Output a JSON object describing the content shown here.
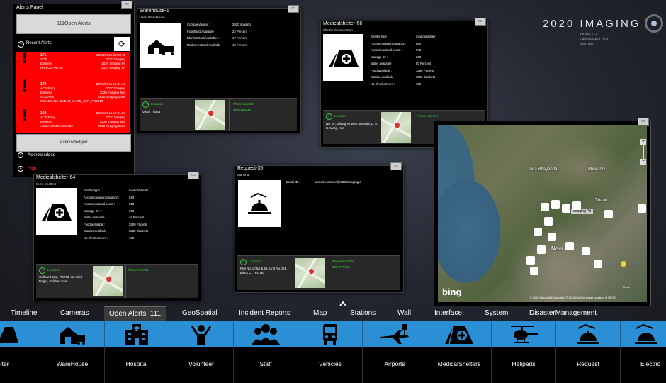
{
  "alerts_panel": {
    "title": "Alerts Panel",
    "open_alerts_button": "111Open Alerts",
    "recent_alerts_label": "Recent Alerts",
    "alerts": [
      {
        "id": "171",
        "type": "SOS",
        "level": "Extreme",
        "detail": "HA SOS Alarms",
        "date": "22/04/2013 12:02:11",
        "org": "2020 Imaging",
        "site": "2020 Imaging Pit",
        "zone": "2020 Imaging FA"
      },
      {
        "id": "170",
        "type": "ACS Entry",
        "level": "Extreme",
        "detail": "ACS Alert 3434401460~EVENT_CARD_NOT_FOUND",
        "date": "22/04/2013 12:01:48",
        "org": "2020 Imaging",
        "site": "2020 Imaging Site",
        "zone": "2020 Imaging Zone"
      },
      {
        "id": "169",
        "type": "ACS Entry",
        "level": "Extreme",
        "detail": "ACS Alert 3434401460~",
        "date": "22/04/2013 12:01:27",
        "org": "2020 Imaging",
        "site": "2020 Imaging Site",
        "zone": "2020 Imaging Zone"
      }
    ],
    "acknowledge_button": "Acknowledged",
    "acknowledged_section": "Acknowledged",
    "high_section": "High"
  },
  "warehouse": {
    "title": "Warehouse-1",
    "subtitle": "Vasai WareHouse",
    "fields": [
      {
        "k": "CompanyName :",
        "v": "2020 imaging"
      },
      {
        "k": "FoodStockAvailable :",
        "v": "22 Percent"
      },
      {
        "k": "BlanketStockAvailable :",
        "v": "17 Percent"
      },
      {
        "k": "MedicinesStockAvailable :",
        "v": "42 Percent"
      }
    ],
    "location_label": "Location",
    "location_value": "Vasai Thana",
    "phone_label": "Phone Number",
    "phone_value": "9560395238"
  },
  "shelter66": {
    "title": "Medicalshelter-66",
    "subtitle": "Shelter Incorporation",
    "fields": [
      {
        "k": "Shelter type :",
        "v": "medicalshelter"
      },
      {
        "k": "Accommodation capacity :",
        "v": "880"
      },
      {
        "k": "Accommodated count :",
        "v": "570"
      },
      {
        "k": "Manage By :",
        "v": "330"
      },
      {
        "k": "Water available :",
        "v": "50 Percent"
      },
      {
        "k": "Food available :",
        "v": "3250 Packets"
      },
      {
        "k": "Blanket available :",
        "v": "2950 Blankets"
      },
      {
        "k": "No of Volunteers :",
        "v": "150"
      }
    ],
    "location_label": "Location",
    "location_value": "No. 67, Shivaji Kutwar Marsdal, L. S. S. Marg, Kurl",
    "phone_label": "Phone Number",
    "phone_value": ""
  },
  "shelter64": {
    "title": "Medicalshelter-64",
    "subtitle": "M. K. Shelters",
    "fields": [
      {
        "k": "Shelter type :",
        "v": "medicalshelter"
      },
      {
        "k": "Accommodation capacity :",
        "v": "540"
      },
      {
        "k": "Accommodated count :",
        "v": "510"
      },
      {
        "k": "Manage By :",
        "v": "270"
      },
      {
        "k": "Water available :",
        "v": "46 Percent"
      },
      {
        "k": "Food available :",
        "v": "2800 Packets"
      },
      {
        "k": "Blanket available :",
        "v": "2230 Blankets"
      },
      {
        "k": "No of Volunteers :",
        "v": "130"
      }
    ],
    "location_label": "Location",
    "location_value": "Golibar Naka, 7th Rd, Jai Hind Nagar, Golibar, Sant",
    "phone_label": "Phone Number",
    "phone_value": ""
  },
  "request": {
    "title": "Request-35",
    "subtitle": "Manohar",
    "email_label": "Email ID :",
    "email_value": "santosh.lamane@2020imaging.c",
    "location_label": "Location",
    "location_value": "Plot No. C/ 54 & 55, Unit No.001, Block C, TPC Bu",
    "phone_label": "Phone Number",
    "phone_value": "9004770840"
  },
  "brand": {
    "name": "2020 IMAGING",
    "line1": "Version V1.2",
    "line2": "India Standard Time",
    "line3": "User: ppm"
  },
  "map": {
    "labels": [
      "Mira Bhayandar",
      "Bhiwandi",
      "Thane",
      "Navi",
      "Imaging Pit"
    ],
    "bing": "bing",
    "copyright": "© 2010 Microsoft Corporation   © 2010 GeoEye Image courtesy of USGS",
    "scale": "5 km"
  },
  "menu": {
    "tabs": [
      "Timeline",
      "Cameras",
      "Open Alerts  111",
      "GeoSpatial",
      "Incident Reports",
      "Map",
      "Stations",
      "Wall",
      "Interface",
      "System",
      "DisasterManagement"
    ],
    "active_tab": "Open Alerts  111",
    "tiles": [
      "elter",
      "WareHouse",
      "Hospital",
      "Volunteer",
      "Staff",
      "Vehicles",
      "Airports",
      "MedicalShelters",
      "Helipads",
      "Request",
      "Electric"
    ]
  },
  "colors": {
    "alert_red": "#ff0000",
    "tile_blue": "#2b8fd6",
    "location_green": "#39d33a"
  }
}
